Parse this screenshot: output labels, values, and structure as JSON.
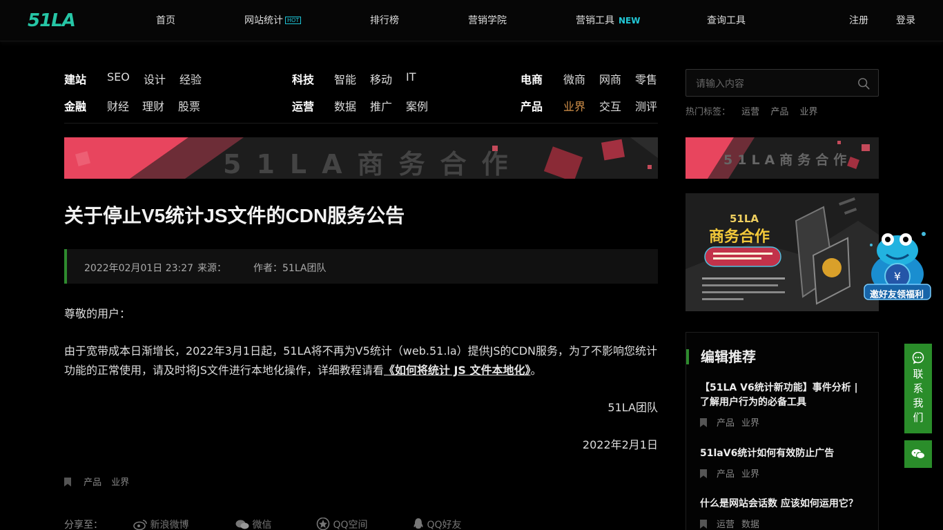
{
  "logo": {
    "text": "51LA"
  },
  "nav": {
    "home": "首页",
    "stats": "网站统计",
    "stats_badge": "HOT",
    "ranking": "排行榜",
    "academy": "营销学院",
    "tools": "营销工具",
    "tools_badge": "NEW",
    "query": "查询工具",
    "register": "注册",
    "login": "登录"
  },
  "categories": {
    "g1": {
      "head1": "建站",
      "items1": [
        "SEO",
        "设计",
        "经验"
      ],
      "head2": "金融",
      "items2": [
        "财经",
        "理财",
        "股票"
      ]
    },
    "g2": {
      "head1": "科技",
      "items1": [
        "智能",
        "移动",
        "IT"
      ],
      "head2": "运营",
      "items2": [
        "数据",
        "推广",
        "案例"
      ]
    },
    "g3": {
      "head1": "电商",
      "items1": [
        "微商",
        "网商",
        "零售"
      ],
      "head2": "产品",
      "items2": [
        "业界",
        "交互",
        "测评"
      ]
    }
  },
  "search": {
    "placeholder": "请输入内容"
  },
  "hot_tags": {
    "label": "热门标签：",
    "tags": [
      "运营",
      "产品",
      "业界"
    ]
  },
  "banner": {
    "main_text": "51LA商务合作",
    "side_text": "51LA商务合作"
  },
  "promo": {
    "brand": "51LA",
    "title": "商务合作",
    "frog_label": "邀好友领福利"
  },
  "article": {
    "title": "关于停止V5统计JS文件的CDN服务公告",
    "date": "2022年02月01日 23:27",
    "source_label": "来源：",
    "author": "作者：51LA团队",
    "greeting": "尊敬的用户：",
    "body_prefix": "由于宽带成本日渐增长，2022年3月1日起，51LA将不再为V5统计（web.51.la）提供JS的CDN服务，为了不影响您统计功能的正常使用，请及时将JS文件进行本地化操作，详细教程请看",
    "body_link": "《如何将统计 JS 文件本地化》",
    "body_suffix": "。",
    "signature": "51LA团队",
    "sign_date": "2022年2月1日",
    "tags": [
      "产品",
      "业界"
    ]
  },
  "share": {
    "label": "分享至：",
    "weibo": "新浪微博",
    "wechat": "微信",
    "qzone": "QQ空间",
    "qq": "QQ好友"
  },
  "recommend": {
    "heading": "编辑推荐",
    "items": [
      {
        "title": "【51LA V6统计新功能】事件分析 | 了解用户行为的必备工具",
        "tags": [
          "产品",
          "业界"
        ]
      },
      {
        "title": "51laV6统计如何有效防止广告",
        "tags": [
          "产品",
          "业界"
        ]
      },
      {
        "title": "什么是网站会话数 应该如何运用它？",
        "tags": [
          "运营",
          "数据"
        ]
      }
    ]
  },
  "float": {
    "contact": [
      "联",
      "系",
      "我",
      "们"
    ]
  },
  "colors": {
    "accent_green": "#2a8d2a",
    "logo": "#26c6a6",
    "active": "#d4924a"
  }
}
